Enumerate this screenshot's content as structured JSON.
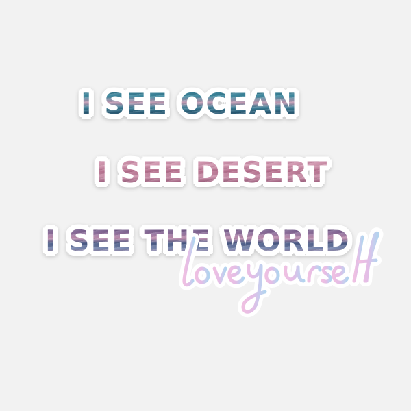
{
  "sticker": {
    "lines": [
      "I SEE OCEAN",
      "I SEE DESERT",
      "I SEE THE WORLD"
    ],
    "signature": "loveyourself"
  },
  "colors": {
    "background": "#f2f2f2",
    "sticker_border": "#ffffff",
    "ocean_tone": "#3f8aa0",
    "desert_tone": "#c07a9a",
    "world_tone": "#7a6a9c",
    "signature_pink": "#e8b4d8",
    "signature_blue": "#b8d4ec"
  }
}
